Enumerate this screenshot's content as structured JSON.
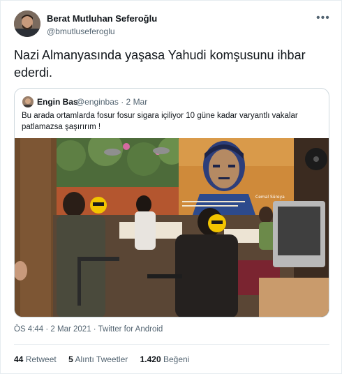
{
  "author": {
    "name": "Berat Mutluhan Seferoğlu",
    "handle": "@bmutluseferoglu"
  },
  "tweet": {
    "text": "Nazi Almanyasında yaşasa Yahudi komşusunu ihbar ederdi.",
    "timestamp": "ÖS 4:44 · 2 Mar 2021",
    "source": "Twitter for Android"
  },
  "quoted": {
    "name": "Engin Bas",
    "handle": "@enginbas · 2 Mar",
    "text": "Bu arada ortamlarda fosur fosur sigara içiliyor 10 güne kadar varyantlı vakalar patlamazsa şaşırırım !",
    "photo_mural_caption": "Cemal Süreya"
  },
  "stats": {
    "retweets": "44",
    "retweets_label": "Retweet",
    "quotes": "5",
    "quotes_label": "Alıntı Tweetler",
    "likes": "1.420",
    "likes_label": "Beğeni"
  },
  "icons": {
    "more": "more-options-icon"
  }
}
